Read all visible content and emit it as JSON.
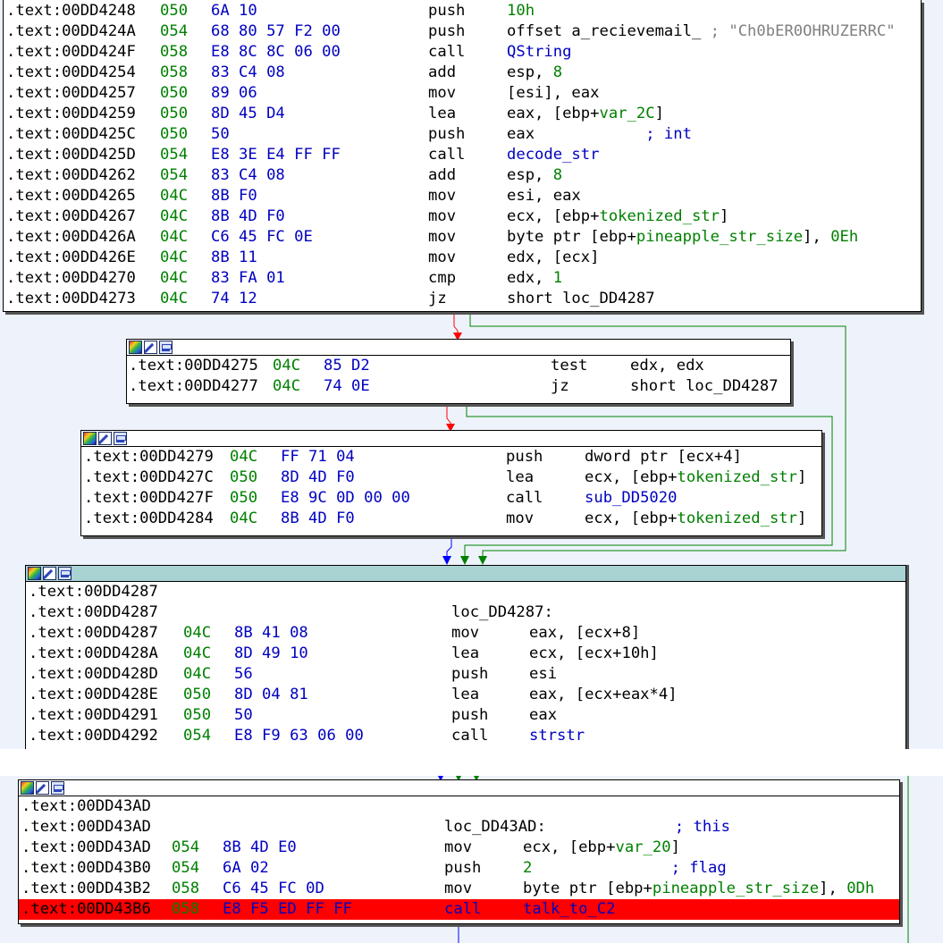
{
  "blocks": [
    {
      "id": "block1",
      "lines": [
        {
          "addr": ".text:00DD4248",
          "sp": "050",
          "bytes": "6A 10",
          "mn": "push",
          "ops": [
            {
              "t": "imm",
              "v": "10h"
            }
          ]
        },
        {
          "addr": ".text:00DD424A",
          "sp": "054",
          "bytes": "68 80 57 F2 00",
          "mn": "push",
          "ops": [
            {
              "t": "plain",
              "v": "offset a_recievemail_"
            },
            {
              "t": "cmt-str",
              "v": " ; \"Ch0bER0OHRUZERRC\""
            }
          ]
        },
        {
          "addr": ".text:00DD424F",
          "sp": "058",
          "bytes": "E8 8C 8C 06 00",
          "mn": "call",
          "ops": [
            {
              "t": "sym",
              "v": "QString"
            }
          ]
        },
        {
          "addr": ".text:00DD4254",
          "sp": "058",
          "bytes": "83 C4 08",
          "mn": "add",
          "ops": [
            {
              "t": "plain",
              "v": "esp, "
            },
            {
              "t": "imm",
              "v": "8"
            }
          ]
        },
        {
          "addr": ".text:00DD4257",
          "sp": "050",
          "bytes": "89 06",
          "mn": "mov",
          "ops": [
            {
              "t": "plain",
              "v": "[esi], eax"
            }
          ]
        },
        {
          "addr": ".text:00DD4259",
          "sp": "050",
          "bytes": "8D 45 D4",
          "mn": "lea",
          "ops": [
            {
              "t": "plain",
              "v": "eax, [ebp+"
            },
            {
              "t": "imm",
              "v": "var_2C"
            },
            {
              "t": "plain",
              "v": "]"
            }
          ]
        },
        {
          "addr": ".text:00DD425C",
          "sp": "050",
          "bytes": "50",
          "mn": "push",
          "ops": [
            {
              "t": "plain",
              "v": "eax"
            },
            {
              "t": "cmt",
              "v": "            ; int"
            }
          ]
        },
        {
          "addr": ".text:00DD425D",
          "sp": "054",
          "bytes": "E8 3E E4 FF FF",
          "mn": "call",
          "ops": [
            {
              "t": "sym",
              "v": "decode_str"
            }
          ]
        },
        {
          "addr": ".text:00DD4262",
          "sp": "054",
          "bytes": "83 C4 08",
          "mn": "add",
          "ops": [
            {
              "t": "plain",
              "v": "esp, "
            },
            {
              "t": "imm",
              "v": "8"
            }
          ]
        },
        {
          "addr": ".text:00DD4265",
          "sp": "04C",
          "bytes": "8B F0",
          "mn": "mov",
          "ops": [
            {
              "t": "plain",
              "v": "esi, eax"
            }
          ]
        },
        {
          "addr": ".text:00DD4267",
          "sp": "04C",
          "bytes": "8B 4D F0",
          "mn": "mov",
          "ops": [
            {
              "t": "plain",
              "v": "ecx, [ebp+"
            },
            {
              "t": "imm",
              "v": "tokenized_str"
            },
            {
              "t": "plain",
              "v": "]"
            }
          ]
        },
        {
          "addr": ".text:00DD426A",
          "sp": "04C",
          "bytes": "C6 45 FC 0E",
          "mn": "mov",
          "ops": [
            {
              "t": "plain",
              "v": "byte ptr [ebp+"
            },
            {
              "t": "imm",
              "v": "pineapple_str_size"
            },
            {
              "t": "plain",
              "v": "], "
            },
            {
              "t": "imm",
              "v": "0Eh"
            }
          ]
        },
        {
          "addr": ".text:00DD426E",
          "sp": "04C",
          "bytes": "8B 11",
          "mn": "mov",
          "ops": [
            {
              "t": "plain",
              "v": "edx, [ecx]"
            }
          ]
        },
        {
          "addr": ".text:00DD4270",
          "sp": "04C",
          "bytes": "83 FA 01",
          "mn": "cmp",
          "ops": [
            {
              "t": "plain",
              "v": "edx, "
            },
            {
              "t": "imm",
              "v": "1"
            }
          ]
        },
        {
          "addr": ".text:00DD4273",
          "sp": "04C",
          "bytes": "74 12",
          "mn": "jz",
          "ops": [
            {
              "t": "plain",
              "v": "short loc_DD4287"
            }
          ]
        }
      ]
    },
    {
      "id": "block2",
      "lines": [
        {
          "addr": ".text:00DD4275",
          "sp": "04C",
          "bytes": "85 D2",
          "mn": "test",
          "ops": [
            {
              "t": "plain",
              "v": "edx, edx"
            }
          ]
        },
        {
          "addr": ".text:00DD4277",
          "sp": "04C",
          "bytes": "74 0E",
          "mn": "jz",
          "ops": [
            {
              "t": "plain",
              "v": "short loc_DD4287"
            }
          ]
        }
      ]
    },
    {
      "id": "block3",
      "lines": [
        {
          "addr": ".text:00DD4279",
          "sp": "04C",
          "bytes": "FF 71 04",
          "mn": "push",
          "ops": [
            {
              "t": "plain",
              "v": "dword ptr [ecx+4]"
            }
          ]
        },
        {
          "addr": ".text:00DD427C",
          "sp": "050",
          "bytes": "8D 4D F0",
          "mn": "lea",
          "ops": [
            {
              "t": "plain",
              "v": "ecx, [ebp+"
            },
            {
              "t": "imm",
              "v": "tokenized_str"
            },
            {
              "t": "plain",
              "v": "]"
            }
          ]
        },
        {
          "addr": ".text:00DD427F",
          "sp": "050",
          "bytes": "E8 9C 0D 00 00",
          "mn": "call",
          "ops": [
            {
              "t": "sym",
              "v": "sub_DD5020"
            }
          ]
        },
        {
          "addr": ".text:00DD4284",
          "sp": "04C",
          "bytes": "8B 4D F0",
          "mn": "mov",
          "ops": [
            {
              "t": "plain",
              "v": "ecx, [ebp+"
            },
            {
              "t": "imm",
              "v": "tokenized_str"
            },
            {
              "t": "plain",
              "v": "]"
            }
          ]
        }
      ]
    },
    {
      "id": "block4",
      "lines": [
        {
          "addr": ".text:00DD4287",
          "sp": "",
          "bytes": "",
          "mn": "",
          "ops": []
        },
        {
          "addr": ".text:00DD4287",
          "sp": "",
          "bytes": "",
          "mn": "",
          "label": "loc_DD4287:",
          "ops": []
        },
        {
          "addr": ".text:00DD4287",
          "sp": "04C",
          "bytes": "8B 41 08",
          "mn": "mov",
          "ops": [
            {
              "t": "plain",
              "v": "eax, [ecx+8]"
            }
          ]
        },
        {
          "addr": ".text:00DD428A",
          "sp": "04C",
          "bytes": "8D 49 10",
          "mn": "lea",
          "ops": [
            {
              "t": "plain",
              "v": "ecx, [ecx+10h]"
            }
          ]
        },
        {
          "addr": ".text:00DD428D",
          "sp": "04C",
          "bytes": "56",
          "mn": "push",
          "ops": [
            {
              "t": "plain",
              "v": "esi"
            }
          ]
        },
        {
          "addr": ".text:00DD428E",
          "sp": "050",
          "bytes": "8D 04 81",
          "mn": "lea",
          "ops": [
            {
              "t": "plain",
              "v": "eax, [ecx+eax*4]"
            }
          ]
        },
        {
          "addr": ".text:00DD4291",
          "sp": "050",
          "bytes": "50",
          "mn": "push",
          "ops": [
            {
              "t": "plain",
              "v": "eax"
            }
          ]
        },
        {
          "addr": ".text:00DD4292",
          "sp": "054",
          "bytes": "E8 F9 63 06 00",
          "mn": "call",
          "ops": [
            {
              "t": "sym",
              "v": "strstr"
            }
          ]
        }
      ]
    },
    {
      "id": "block5",
      "lines": [
        {
          "addr": ".text:00DD43AD",
          "sp": "",
          "bytes": "",
          "mn": "",
          "ops": []
        },
        {
          "addr": ".text:00DD43AD",
          "sp": "",
          "bytes": "",
          "mn": "",
          "label": "loc_DD43AD:",
          "ops": [
            {
              "t": "cmt",
              "v": "              ; this"
            }
          ]
        },
        {
          "addr": ".text:00DD43AD",
          "sp": "054",
          "bytes": "8B 4D E0",
          "mn": "mov",
          "ops": [
            {
              "t": "plain",
              "v": "ecx, [ebp+"
            },
            {
              "t": "imm",
              "v": "var_20"
            },
            {
              "t": "plain",
              "v": "]"
            }
          ]
        },
        {
          "addr": ".text:00DD43B0",
          "sp": "054",
          "bytes": "6A 02",
          "mn": "push",
          "ops": [
            {
              "t": "imm",
              "v": "2"
            },
            {
              "t": "cmt",
              "v": "               ; flag"
            }
          ]
        },
        {
          "addr": ".text:00DD43B2",
          "sp": "058",
          "bytes": "C6 45 FC 0D",
          "mn": "mov",
          "ops": [
            {
              "t": "plain",
              "v": "byte ptr [ebp+"
            },
            {
              "t": "imm",
              "v": "pineapple_str_size"
            },
            {
              "t": "plain",
              "v": "], "
            },
            {
              "t": "imm",
              "v": "0Dh"
            }
          ]
        },
        {
          "addr": ".text:00DD43B6",
          "sp": "058",
          "bytes": "E8 F5 ED FF FF",
          "mn": "call",
          "highlight": true,
          "ops": [
            {
              "t": "sym",
              "v": "talk_to_C2"
            }
          ]
        }
      ]
    }
  ],
  "colors": {
    "background": "#eef3fb",
    "highlight": "#ff0000",
    "stack": "#008000",
    "bytes": "#0000c0",
    "edge_true": "#008000",
    "edge_false": "#ff0000",
    "edge_uncond": "#0000ff",
    "header_teal": "#a9d2d3"
  },
  "icons": [
    "palette-icon",
    "edit-icon",
    "graph-icon"
  ]
}
